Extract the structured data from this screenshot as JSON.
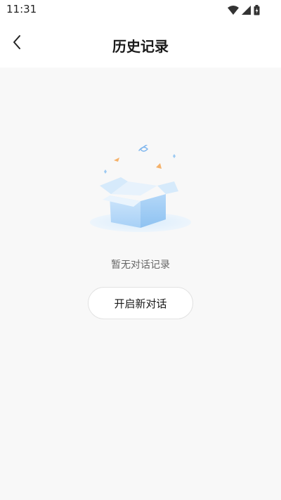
{
  "status_bar": {
    "time": "11:31",
    "icons": [
      "wifi-icon",
      "signal-icon",
      "battery-icon"
    ]
  },
  "nav": {
    "back_icon": "chevron-left-icon",
    "title": "历史记录"
  },
  "empty_state": {
    "illustration": "open-box-illustration",
    "message": "暂无对话记录",
    "button_label": "开启新对话"
  },
  "colors": {
    "page_background": "#f8f8f8",
    "header_background": "#ffffff",
    "box_blue": "#9dcbf5",
    "confetti_orange": "#f5b26b"
  }
}
